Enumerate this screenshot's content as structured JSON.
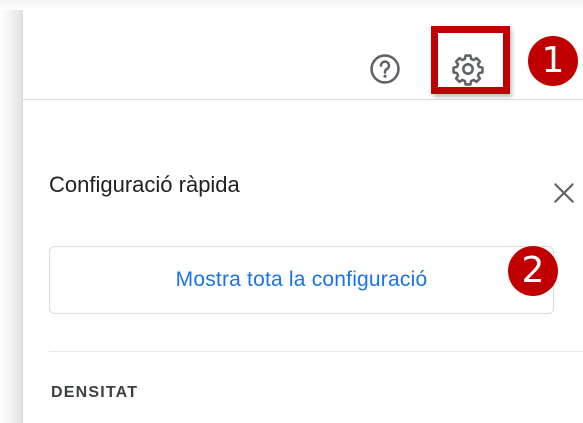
{
  "quick_settings": {
    "title": "Configuració ràpida",
    "all_settings_label": "Mostra tota la configuració",
    "density_header": "DENSITAT"
  },
  "icons": {
    "help": "help-icon",
    "settings": "settings-gear-icon",
    "close": "close-icon"
  },
  "annotations": {
    "step1": "1",
    "step2": "2"
  },
  "colors": {
    "annotation_red": "#c00000",
    "link_blue": "#1a73e8",
    "border_gray": "#dadce0",
    "icon_gray": "#5f6368"
  }
}
